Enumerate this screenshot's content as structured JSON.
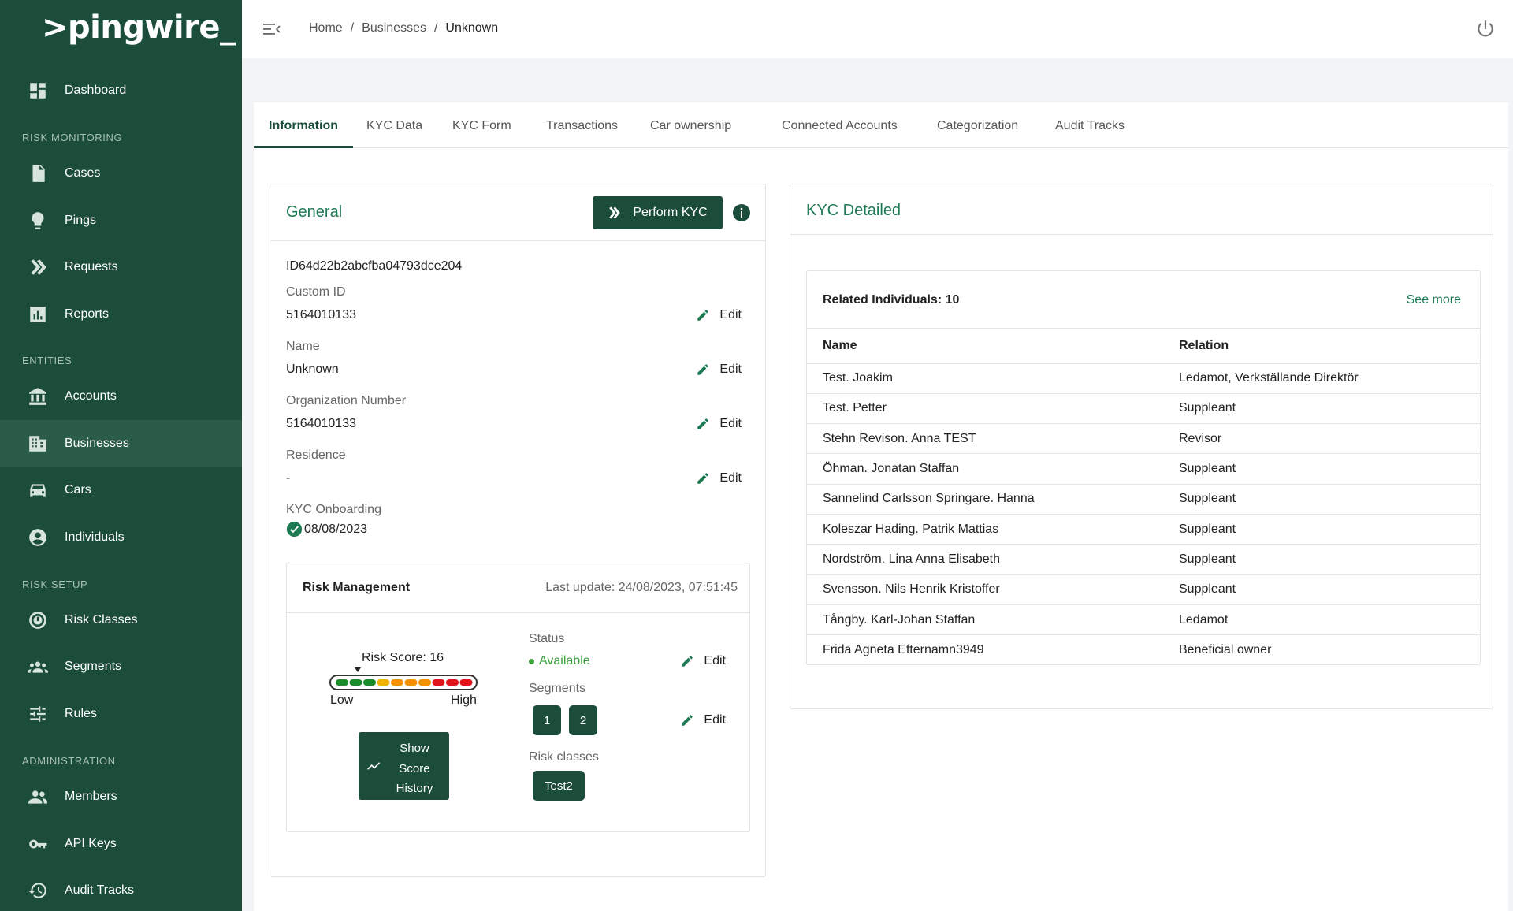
{
  "app": {
    "logo": ">pingwire_"
  },
  "sidebar": {
    "items": [
      {
        "label": "Dashboard"
      },
      {
        "label": "Cases"
      },
      {
        "label": "Pings"
      },
      {
        "label": "Requests"
      },
      {
        "label": "Reports"
      },
      {
        "label": "Accounts"
      },
      {
        "label": "Businesses"
      },
      {
        "label": "Cars"
      },
      {
        "label": "Individuals"
      },
      {
        "label": "Risk Classes"
      },
      {
        "label": "Segments"
      },
      {
        "label": "Rules"
      },
      {
        "label": "Members"
      },
      {
        "label": "API Keys"
      },
      {
        "label": "Audit Tracks"
      }
    ],
    "sections": {
      "risk_monitoring": "RISK MONITORING",
      "entities": "ENTITIES",
      "risk_setup": "RISK SETUP",
      "administration": "ADMINISTRATION"
    },
    "active_item": "Businesses"
  },
  "breadcrumb": {
    "home": "Home",
    "sep": "/",
    "businesses": "Businesses",
    "current": "Unknown"
  },
  "tabs": [
    {
      "label": "Information"
    },
    {
      "label": "KYC Data"
    },
    {
      "label": "KYC Form"
    },
    {
      "label": "Transactions"
    },
    {
      "label": "Car ownership"
    },
    {
      "label": "Connected Accounts"
    },
    {
      "label": "Categorization"
    },
    {
      "label": "Audit Tracks"
    }
  ],
  "general": {
    "title": "General",
    "perform_kyc": "Perform KYC",
    "id_text": "ID64d22b2abcfba04793dce204",
    "edit_label": "Edit",
    "fields": {
      "custom_id_label": "Custom ID",
      "custom_id_value": "5164010133",
      "name_label": "Name",
      "name_value": "Unknown",
      "org_label": "Organization Number",
      "org_value": "5164010133",
      "residence_label": "Residence",
      "residence_value": "-",
      "kyc_label": "KYC Onboarding",
      "kyc_value": "08/08/2023"
    }
  },
  "risk": {
    "title": "Risk Management",
    "last_update": "Last update: 24/08/2023, 07:51:45",
    "score_label": "Risk Score: 16",
    "score": 16,
    "low": "Low",
    "high": "High",
    "history_line1": "Show",
    "history_line2": "Score",
    "history_line3": "History",
    "status_label": "Status",
    "status_value": "Available",
    "segments_label": "Segments",
    "segments": [
      "1",
      "2"
    ],
    "risk_classes_label": "Risk classes",
    "risk_class": "Test2",
    "colors": {
      "green": "#1a8a2a",
      "yellow": "#f0b400",
      "orange": "#f39200",
      "red": "#e2141b"
    }
  },
  "kyc": {
    "title": "KYC Detailed",
    "related_title": "Related Individuals: 10",
    "see_more": "See more",
    "columns": [
      "Name",
      "Relation"
    ],
    "rows": [
      [
        "Test. Joakim",
        "Ledamot, Verkställande Direktör"
      ],
      [
        "Test. Petter",
        "Suppleant"
      ],
      [
        "Stehn Revison. Anna TEST",
        "Revisor"
      ],
      [
        "Öhman. Jonatan Staffan",
        "Suppleant"
      ],
      [
        "Sannelind Carlsson Springare. Hanna",
        "Suppleant"
      ],
      [
        "Koleszar Hading. Patrik Mattias",
        "Suppleant"
      ],
      [
        "Nordström. Lina Anna Elisabeth",
        "Suppleant"
      ],
      [
        "Svensson. Nils Henrik Kristoffer",
        "Suppleant"
      ],
      [
        "Tångby. Karl-Johan Staffan",
        "Ledamot"
      ],
      [
        "Frida Agneta Efternamn3949",
        "Beneficial owner"
      ]
    ]
  }
}
